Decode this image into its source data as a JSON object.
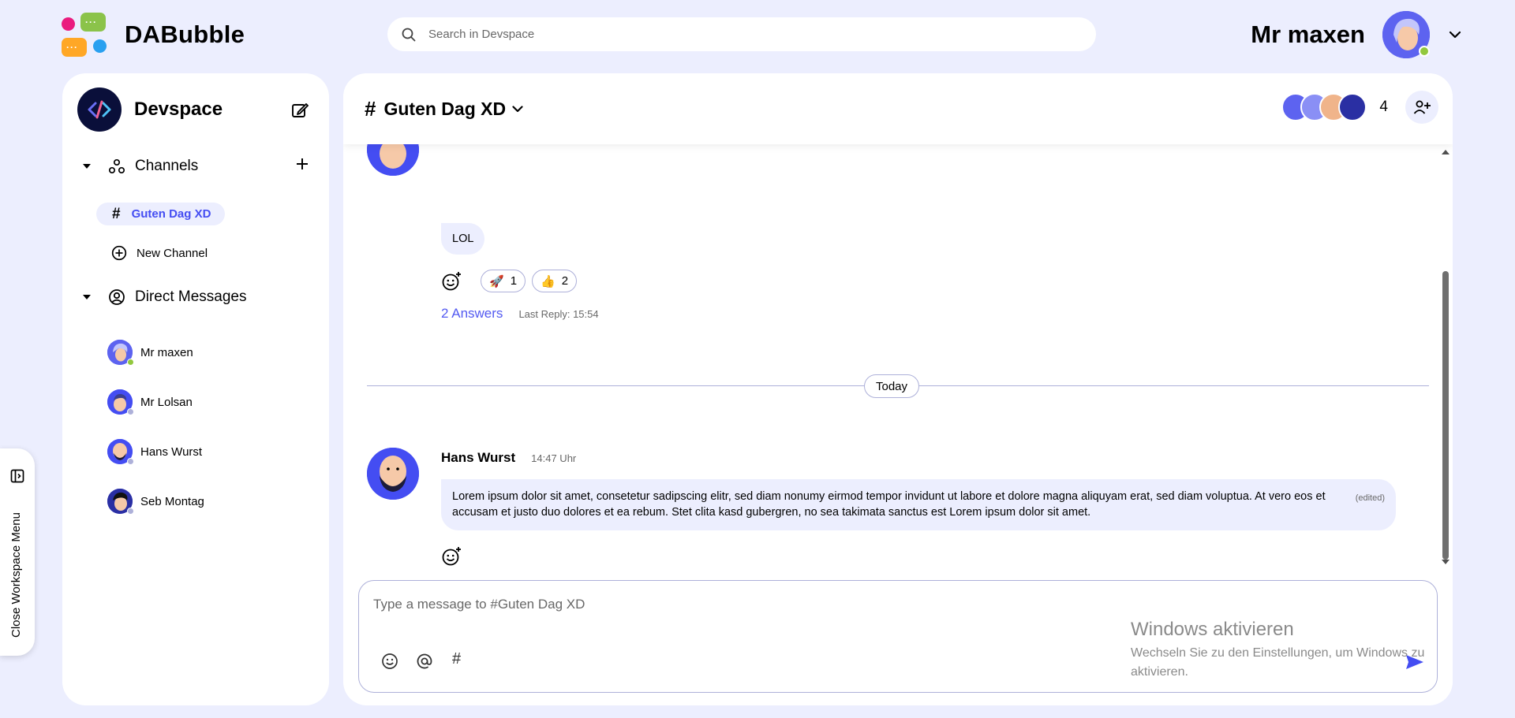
{
  "app": {
    "name": "DABubble"
  },
  "search": {
    "placeholder": "Search in Devspace"
  },
  "current_user": {
    "name": "Mr maxen",
    "status_color": "#92c83e"
  },
  "workspace": {
    "name": "Devspace"
  },
  "sidebar": {
    "channels_label": "Channels",
    "channels": [
      {
        "label": "Guten Dag XD",
        "active": true
      }
    ],
    "new_channel_label": "New Channel",
    "dm_label": "Direct Messages",
    "direct_messages": [
      {
        "name": "Mr maxen",
        "online": true
      },
      {
        "name": "Mr Lolsan",
        "online": false
      },
      {
        "name": "Hans Wurst",
        "online": false
      },
      {
        "name": "Seb Montag",
        "online": false
      }
    ]
  },
  "workspace_toggle": {
    "label": "Close Workspace Menu"
  },
  "channel": {
    "title": "Guten Dag XD",
    "member_count": "4"
  },
  "messages": [
    {
      "text": "LOL",
      "reactions": [
        {
          "emoji": "🚀",
          "count": "1"
        },
        {
          "emoji": "👍",
          "count": "2"
        }
      ],
      "answers_label": "2 Answers",
      "last_reply": "Last Reply: 15:54"
    },
    {
      "author": "Hans Wurst",
      "time": "14:47 Uhr",
      "text": "Lorem ipsum dolor sit amet, consetetur sadipscing elitr, sed diam nonumy eirmod tempor invidunt ut labore et dolore magna aliquyam erat, sed diam voluptua. At vero eos et accusam et justo duo dolores et ea rebum. Stet clita kasd gubergren, no sea takimata sanctus est Lorem ipsum dolor sit amet.",
      "edited_label": "(edited)"
    }
  ],
  "divider": {
    "label": "Today"
  },
  "composer": {
    "placeholder": "Type a message to #Guten Dag XD"
  },
  "watermark": {
    "title": "Windows aktivieren",
    "subtitle": "Wechseln Sie zu den Einstellungen, um Windows zu aktivieren."
  },
  "colors": {
    "accent": "#444df2",
    "background": "#eceefe",
    "online": "#92c83e",
    "offline": "#adb0d9"
  }
}
